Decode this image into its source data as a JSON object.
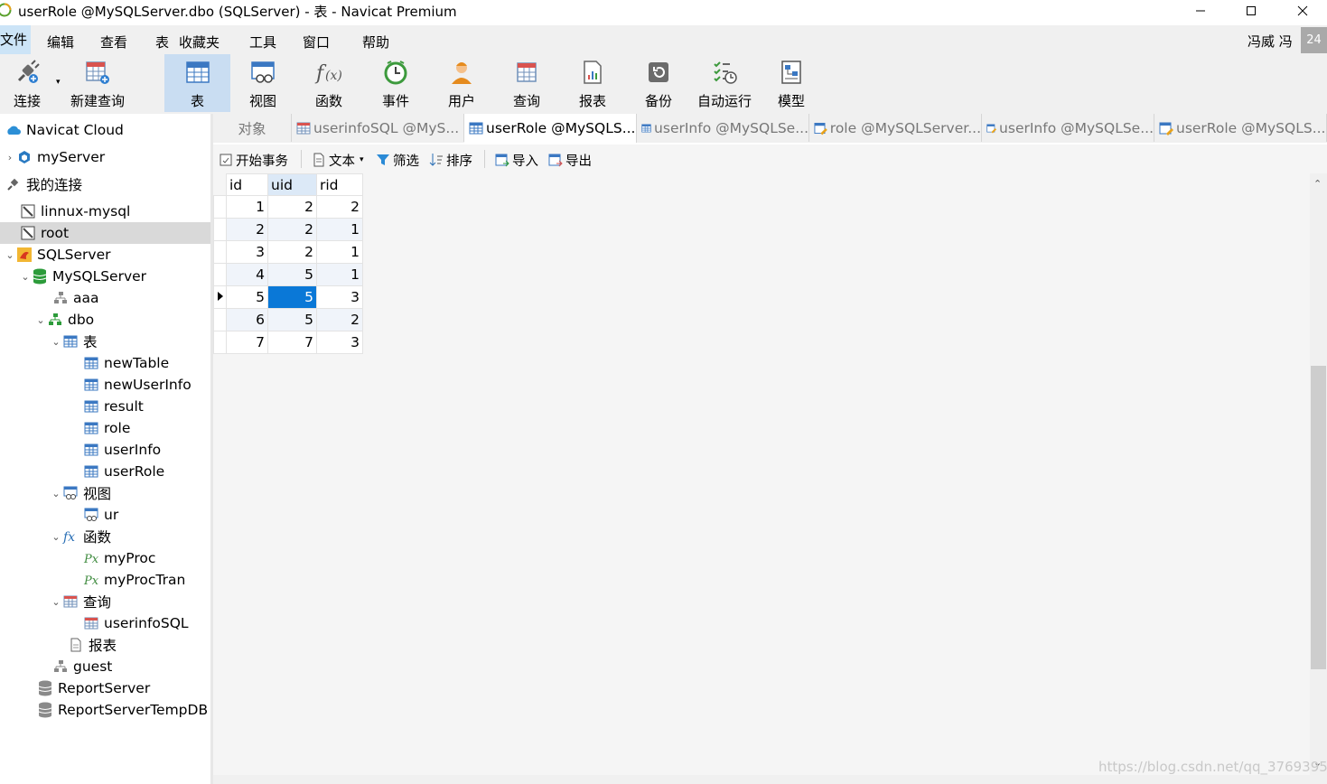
{
  "window": {
    "title": "userRole @MySQLServer.dbo (SQLServer) - 表 - Navicat Premium",
    "controls": [
      "minimize",
      "maximize",
      "close"
    ]
  },
  "menu": {
    "items": [
      "文件",
      "编辑",
      "查看",
      "表",
      "收藏夹",
      "工具",
      "窗口",
      "帮助"
    ],
    "user_name": "冯威 冯",
    "user_badge": "24"
  },
  "toolbar": {
    "items": [
      {
        "label": "连接",
        "icon": "connection-plug-icon"
      },
      {
        "label": "新建查询",
        "icon": "new-query-icon"
      },
      {
        "label": "表",
        "icon": "table-icon",
        "active": true
      },
      {
        "label": "视图",
        "icon": "view-icon"
      },
      {
        "label": "函数",
        "icon": "function-icon"
      },
      {
        "label": "事件",
        "icon": "event-clock-icon"
      },
      {
        "label": "用户",
        "icon": "user-icon"
      },
      {
        "label": "查询",
        "icon": "query-icon"
      },
      {
        "label": "报表",
        "icon": "report-icon"
      },
      {
        "label": "备份",
        "icon": "backup-icon"
      },
      {
        "label": "自动运行",
        "icon": "automation-icon"
      },
      {
        "label": "模型",
        "icon": "model-icon"
      }
    ]
  },
  "sidebar": {
    "nodes": [
      {
        "label": "Navicat Cloud",
        "icon": "cloud-icon"
      },
      {
        "label": "myServer",
        "icon": "server-icon"
      },
      {
        "label": "我的连接",
        "icon": "connection-icon"
      },
      {
        "label": "linnux-mysql",
        "icon": "connection-icon"
      },
      {
        "label": "root",
        "icon": "connection-icon"
      },
      {
        "label": "SQLServer",
        "icon": "sqlserver-icon"
      },
      {
        "label": "MySQLServer",
        "icon": "database-icon"
      },
      {
        "label": "aaa",
        "icon": "schema-icon"
      },
      {
        "label": "dbo",
        "icon": "schema-icon"
      },
      {
        "label": "表",
        "icon": "table-folder-icon"
      },
      {
        "label": "newTable",
        "icon": "table-icon"
      },
      {
        "label": "newUserInfo",
        "icon": "table-icon"
      },
      {
        "label": "result",
        "icon": "table-icon"
      },
      {
        "label": "role",
        "icon": "table-icon"
      },
      {
        "label": "userInfo",
        "icon": "table-icon"
      },
      {
        "label": "userRole",
        "icon": "table-icon"
      },
      {
        "label": "视图",
        "icon": "view-folder-icon"
      },
      {
        "label": "ur",
        "icon": "view-icon"
      },
      {
        "label": "函数",
        "icon": "function-folder-icon"
      },
      {
        "label": "myProc",
        "icon": "function-icon"
      },
      {
        "label": "myProcTran",
        "icon": "function-icon"
      },
      {
        "label": "查询",
        "icon": "query-folder-icon"
      },
      {
        "label": "userinfoSQL",
        "icon": "query-icon"
      },
      {
        "label": "报表",
        "icon": "report-icon"
      },
      {
        "label": "guest",
        "icon": "schema-icon"
      },
      {
        "label": "ReportServer",
        "icon": "database-gray-icon"
      },
      {
        "label": "ReportServerTempDB",
        "icon": "database-gray-icon"
      }
    ]
  },
  "tabs": [
    {
      "label": "对象"
    },
    {
      "label": "userinfoSQL @MyS..."
    },
    {
      "label": "userRole @MySQLS...",
      "active": true
    },
    {
      "label": "userInfo @MySQLSe..."
    },
    {
      "label": "role @MySQLServer..."
    },
    {
      "label": "userInfo @MySQLSe..."
    },
    {
      "label": "userRole @MySQLS..."
    }
  ],
  "subtoolbar": {
    "begin_transaction": "开始事务",
    "text": "文本",
    "filter": "筛选",
    "sort": "排序",
    "import": "导入",
    "export": "导出"
  },
  "grid": {
    "columns": [
      "id",
      "uid",
      "rid"
    ],
    "rows": [
      [
        "1",
        "2",
        "2"
      ],
      [
        "2",
        "2",
        "1"
      ],
      [
        "3",
        "2",
        "1"
      ],
      [
        "4",
        "5",
        "1"
      ],
      [
        "5",
        "5",
        "3"
      ],
      [
        "6",
        "5",
        "2"
      ],
      [
        "7",
        "7",
        "3"
      ]
    ],
    "current_row": 4,
    "selected_column": 1
  },
  "watermark": "https://blog.csdn.net/qq_3769395"
}
